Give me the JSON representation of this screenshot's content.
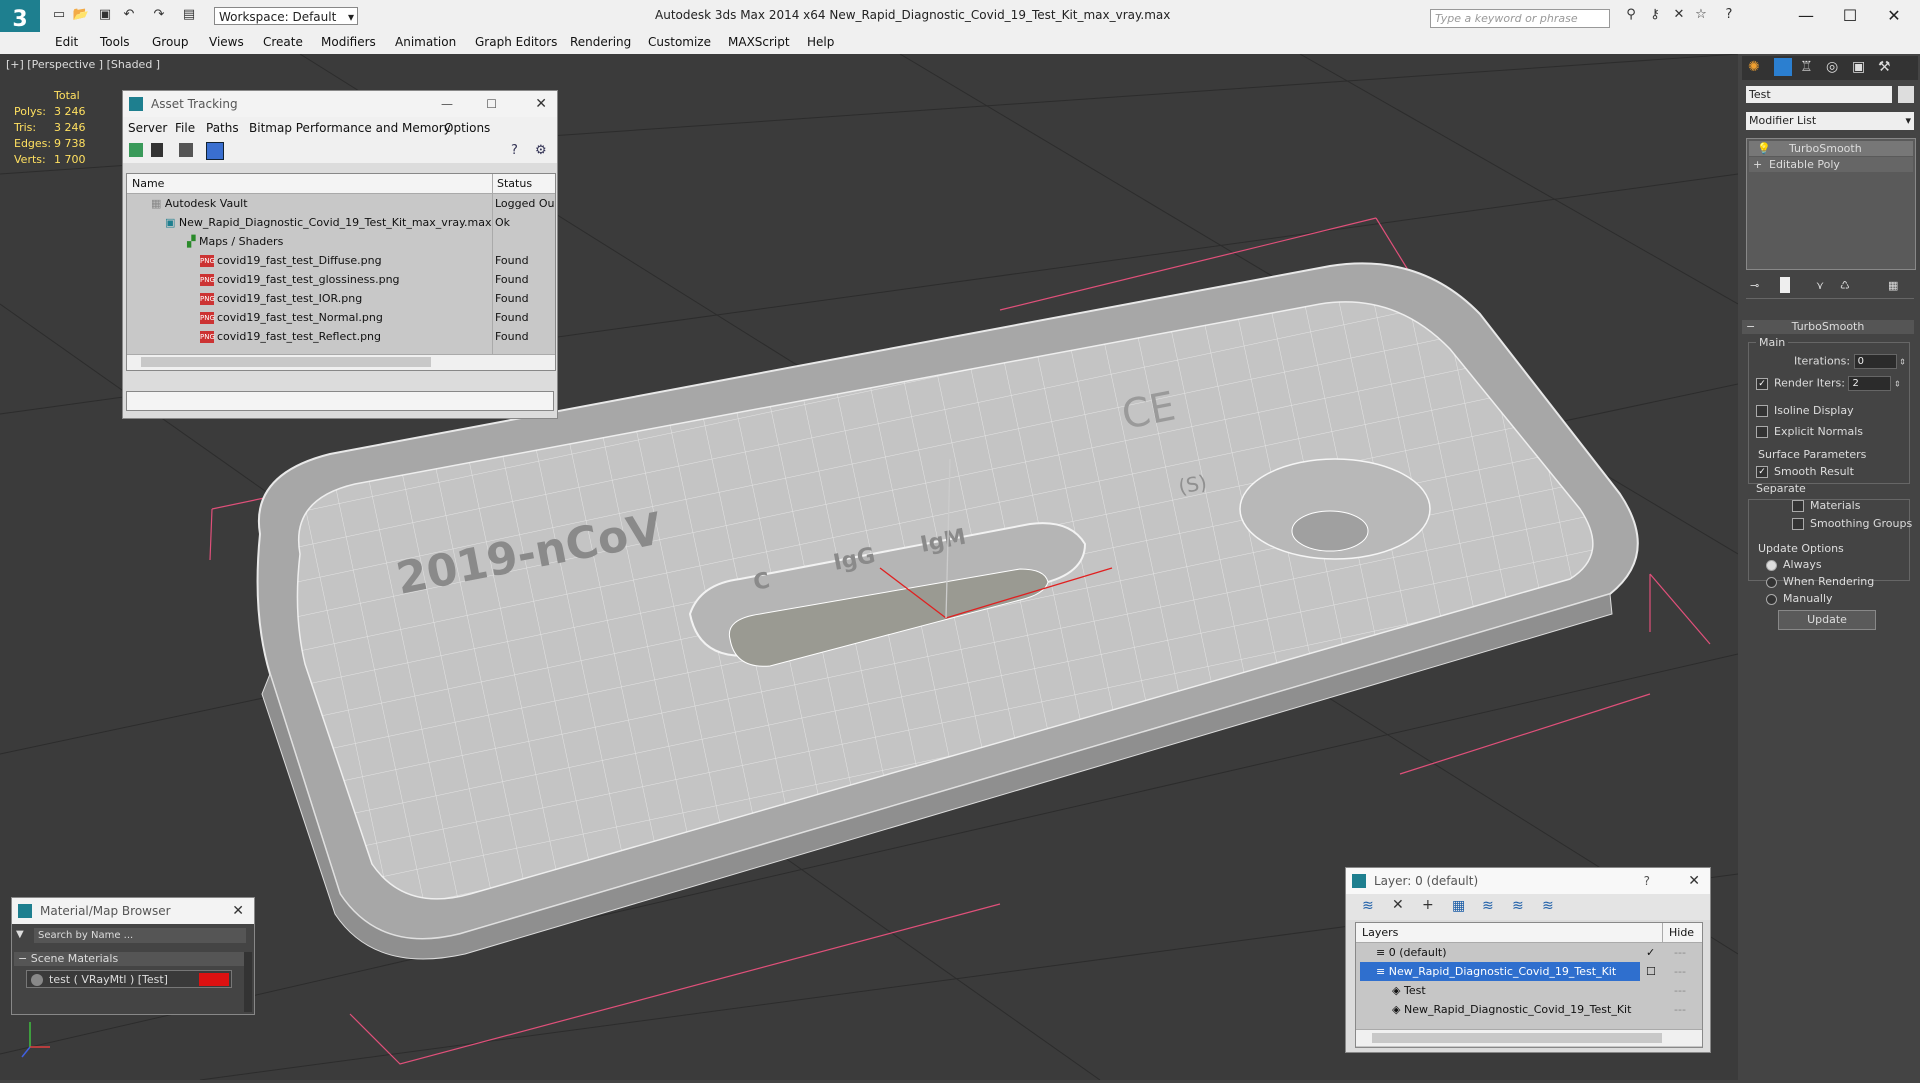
{
  "app": {
    "title": "Autodesk 3ds Max  2014 x64      New_Rapid_Diagnostic_Covid_19_Test_Kit_max_vray.max",
    "workspace": "Workspace: Default",
    "search_placeholder": "Type a keyword or phrase"
  },
  "menubar": [
    "Edit",
    "Tools",
    "Group",
    "Views",
    "Create",
    "Modifiers",
    "Animation",
    "Graph Editors",
    "Rendering",
    "Customize",
    "MAXScript",
    "Help"
  ],
  "viewport": {
    "label": "[+] [Perspective ] [Shaded ]",
    "stats": {
      "total": "Total",
      "rows": [
        {
          "label": "Polys:",
          "value": "3 246"
        },
        {
          "label": "Tris:",
          "value": "3 246"
        },
        {
          "label": "Edges:",
          "value": "9 738"
        },
        {
          "label": "Verts:",
          "value": "1 700"
        }
      ]
    },
    "model_text": {
      "brand": "2019-nCoV",
      "c": "C",
      "igg": "IgG",
      "igm": "IgM",
      "ce": "CE",
      "s": "(S)"
    }
  },
  "asset_tracking": {
    "title": "Asset Tracking",
    "menu": [
      "Server",
      "File",
      "Paths",
      "Bitmap Performance and Memory",
      "Options"
    ],
    "columns": {
      "name": "Name",
      "status": "Status"
    },
    "rows": [
      {
        "name": "Autodesk Vault",
        "status": "Logged Ou"
      },
      {
        "name": "New_Rapid_Diagnostic_Covid_19_Test_Kit_max_vray.max",
        "status": "Ok"
      },
      {
        "name": "Maps / Shaders",
        "status": ""
      },
      {
        "name": "covid19_fast_test_Diffuse.png",
        "status": "Found"
      },
      {
        "name": "covid19_fast_test_glossiness.png",
        "status": "Found"
      },
      {
        "name": "covid19_fast_test_IOR.png",
        "status": "Found"
      },
      {
        "name": "covid19_fast_test_Normal.png",
        "status": "Found"
      },
      {
        "name": "covid19_fast_test_Reflect.png",
        "status": "Found"
      }
    ],
    "png_tag": "PNG"
  },
  "material_browser": {
    "title": "Material/Map Browser",
    "search_placeholder": "Search by Name ...",
    "section": "Scene Materials",
    "item": "test  ( VRayMtl )  [Test]"
  },
  "layer_panel": {
    "title": "Layer: 0 (default)",
    "help": "?",
    "col_layers": "Layers",
    "col_hide": "Hide",
    "rows": [
      {
        "name": "0 (default)"
      },
      {
        "name": "New_Rapid_Diagnostic_Covid_19_Test_Kit"
      },
      {
        "name": "Test"
      },
      {
        "name": "New_Rapid_Diagnostic_Covid_19_Test_Kit"
      }
    ]
  },
  "command_panel": {
    "object_name": "Test",
    "modifier_list": "Modifier List",
    "stack": [
      "TurboSmooth",
      "Editable Poly"
    ],
    "rollout_title": "TurboSmooth",
    "main": "Main",
    "iterations_label": "Iterations:",
    "iterations_value": "0",
    "render_iters_label": "Render Iters:",
    "render_iters_value": "2",
    "isoline": "Isoline Display",
    "explicit_normals": "Explicit Normals",
    "surface_params": "Surface Parameters",
    "smooth_result": "Smooth Result",
    "separate": "Separate",
    "materials": "Materials",
    "smoothing_groups": "Smoothing Groups",
    "update_options": "Update Options",
    "always": "Always",
    "when_rendering": "When Rendering",
    "manually": "Manually",
    "update_button": "Update"
  },
  "colors": {
    "accent": "#1e7f8f",
    "selection": "#2f6fce",
    "stats_yellow": "#ffe060",
    "bbox_pink": "#e0507a"
  }
}
